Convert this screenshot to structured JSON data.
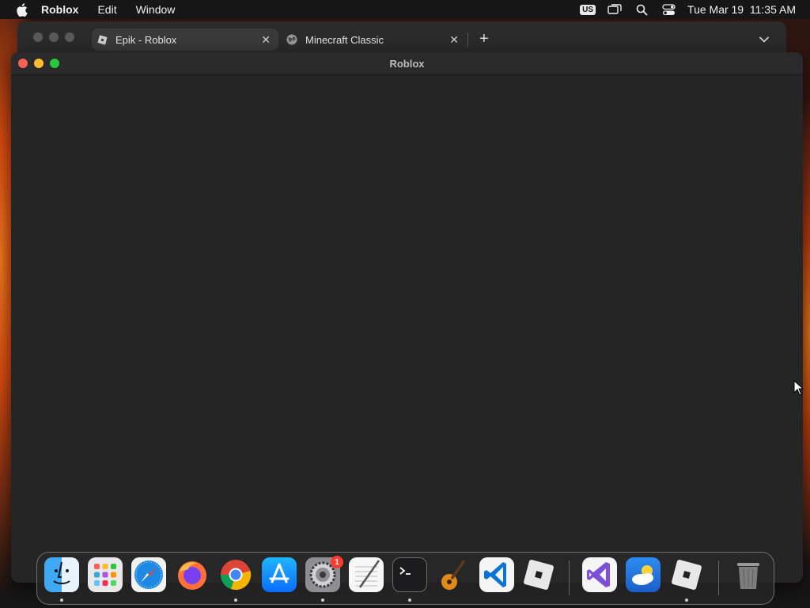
{
  "menubar": {
    "app_name": "Roblox",
    "items": [
      "Edit",
      "Window"
    ],
    "input_source": "US",
    "datetime": "Tue Mar 19  11:35 AM"
  },
  "browser": {
    "tabs": [
      {
        "title": "Epik - Roblox",
        "icon": "roblox-icon",
        "active": true
      },
      {
        "title": "Minecraft Classic",
        "icon": "globe-icon",
        "active": false
      }
    ]
  },
  "roblox_window": {
    "title": "Roblox"
  },
  "dock": {
    "apps": [
      "Finder",
      "Launchpad",
      "Safari",
      "Firefox",
      "Chrome",
      "App Store",
      "System Settings",
      "TextEdit",
      "Terminal",
      "GarageBand",
      "VS Code",
      "Roblox",
      "Visual Studio",
      "Weather",
      "Roblox Studio",
      "Trash"
    ],
    "settings_badge": "1"
  },
  "colors": {
    "close": "#fe5f57",
    "minimize": "#febc2e",
    "zoom": "#28c840",
    "badge": "#ff3b30"
  }
}
